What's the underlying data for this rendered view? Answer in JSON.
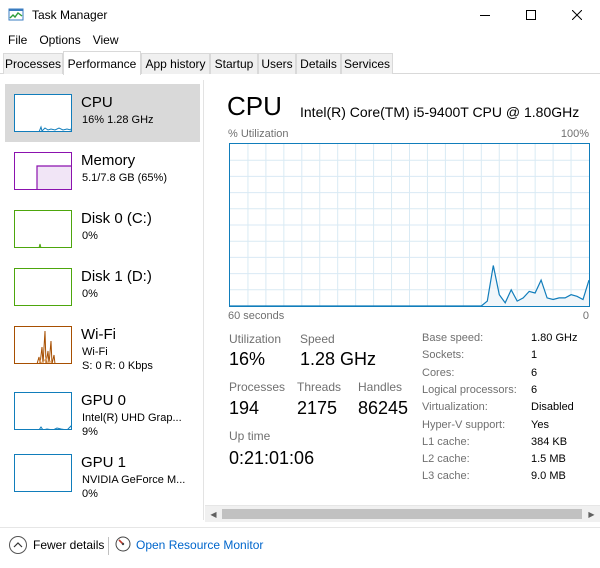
{
  "window": {
    "title": "Task Manager"
  },
  "menu": [
    "File",
    "Options",
    "View"
  ],
  "tabs": [
    "Processes",
    "Performance",
    "App history",
    "Startup",
    "Users",
    "Details",
    "Services"
  ],
  "active_tab": "Performance",
  "sidebar": [
    {
      "title": "CPU",
      "line1": "16%  1.28 GHz",
      "line2": "",
      "color": "#117dbb"
    },
    {
      "title": "Memory",
      "line1": "5.1/7.8 GB (65%)",
      "line2": "",
      "color": "#8b12ae"
    },
    {
      "title": "Disk 0 (C:)",
      "line1": "0%",
      "line2": "",
      "color": "#4da60c"
    },
    {
      "title": "Disk 1 (D:)",
      "line1": "0%",
      "line2": "",
      "color": "#4da60c"
    },
    {
      "title": "Wi-Fi",
      "line1": "Wi-Fi",
      "line2": "S: 0  R: 0 Kbps",
      "color": "#a74f01"
    },
    {
      "title": "GPU 0",
      "line1": "Intel(R) UHD Grap...",
      "line2": "9%",
      "color": "#117dbb"
    },
    {
      "title": "GPU 1",
      "line1": "NVIDIA GeForce M...",
      "line2": "0%",
      "color": "#117dbb"
    }
  ],
  "main": {
    "title": "CPU",
    "cpu_name": "Intel(R) Core(TM) i5-9400T CPU @ 1.80GHz",
    "util_label": "% Utilization",
    "util_max": "100%",
    "axis_left": "60 seconds",
    "axis_right": "0",
    "graph_color": "#117dbb",
    "stats": {
      "utilization_label": "Utilization",
      "utilization": "16%",
      "speed_label": "Speed",
      "speed": "1.28 GHz",
      "processes_label": "Processes",
      "processes": "194",
      "threads_label": "Threads",
      "threads": "2175",
      "handles_label": "Handles",
      "handles": "86245",
      "uptime_label": "Up time",
      "uptime": "0:21:01:06"
    },
    "specs": [
      {
        "label": "Base speed:",
        "value": "1.80 GHz"
      },
      {
        "label": "Sockets:",
        "value": "1"
      },
      {
        "label": "Cores:",
        "value": "6"
      },
      {
        "label": "Logical processors:",
        "value": "6"
      },
      {
        "label": "Virtualization:",
        "value": "Disabled"
      },
      {
        "label": "Hyper-V support:",
        "value": "Yes"
      },
      {
        "label": "L1 cache:",
        "value": "384 KB"
      },
      {
        "label": "L2 cache:",
        "value": "1.5 MB"
      },
      {
        "label": "L3 cache:",
        "value": "9.0 MB"
      }
    ]
  },
  "footer": {
    "fewer_details": "Fewer details",
    "open_monitor": "Open Resource Monitor"
  },
  "chart_data": {
    "type": "area",
    "ylim": [
      0,
      100
    ],
    "x": [
      0,
      1,
      2,
      3,
      4,
      5,
      6,
      7,
      8,
      9,
      10,
      11,
      12,
      13,
      14,
      15,
      16,
      17,
      18,
      19,
      20,
      21,
      22,
      23,
      24,
      25,
      26,
      27,
      28,
      29,
      30,
      31,
      32,
      33,
      34,
      35,
      36,
      37,
      38,
      39,
      40,
      41,
      42,
      43,
      44,
      45,
      46,
      47,
      48,
      49,
      50,
      51,
      52,
      53,
      54,
      55,
      56,
      57,
      58,
      59,
      60
    ],
    "values": [
      0,
      0,
      0,
      0,
      0,
      0,
      0,
      0,
      0,
      0,
      0,
      0,
      0,
      0,
      0,
      0,
      0,
      0,
      0,
      0,
      0,
      0,
      0,
      0,
      0,
      0,
      0,
      0,
      0,
      0,
      0,
      0,
      0,
      0,
      0,
      0,
      0,
      0,
      0,
      0,
      0,
      0,
      0,
      3,
      25,
      7,
      2,
      10,
      3,
      5,
      9,
      8,
      16,
      5,
      4,
      5,
      5,
      7,
      6,
      4,
      16
    ]
  }
}
